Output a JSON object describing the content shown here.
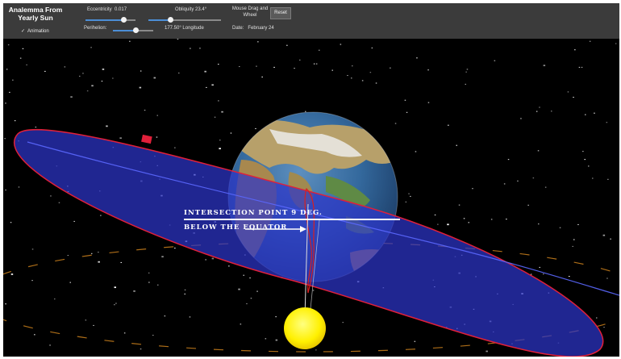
{
  "app": {
    "title": "Analemma From Yearly Sun",
    "animation_label": "Animation",
    "animation_checked": true
  },
  "controls": {
    "eccentricity": {
      "label": "Eccentricity",
      "value": "0.017",
      "fraction": 0.75
    },
    "obliquity": {
      "label": "Obliquity",
      "value": "23.4°",
      "fraction": 0.3
    },
    "perihelion": {
      "label": "Perihelion:",
      "fraction": 0.55,
      "longitude": "177.50° Longitude"
    },
    "mouse_hint": "Mouse Drag and Wheel",
    "reset_label": "Reset",
    "date_label": "Date:",
    "date_value": "February 24"
  },
  "annotation": {
    "line1": "INTERSECTION POINT 9 DEG.",
    "line2": "BELOW THE EQUATOR"
  },
  "colors": {
    "toolbar": "#3b3b3b",
    "orbit_fill": "#2d34c9",
    "orbit_edge": "#e0203a",
    "sun": "#ffee00",
    "slider_fill": "#4c8ed6"
  }
}
